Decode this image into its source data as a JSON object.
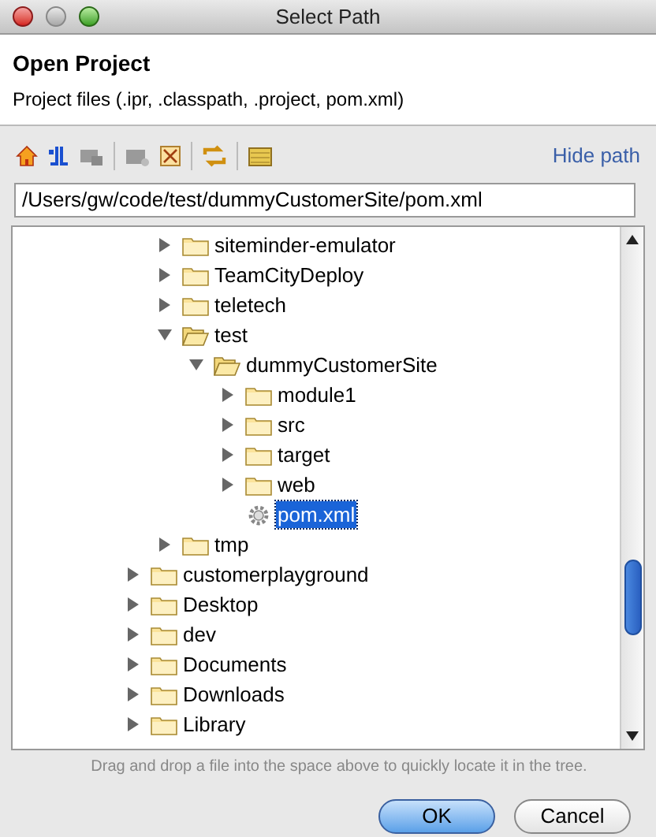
{
  "window": {
    "title": "Select Path"
  },
  "header": {
    "title": "Open Project",
    "subtitle": "Project files (.ipr, .classpath, .project, pom.xml)"
  },
  "toolbar": {
    "hide_path_link": "Hide path"
  },
  "path_field": {
    "value": "/Users/gw/code/test/dummyCustomerSite/pom.xml"
  },
  "tree": {
    "items": [
      {
        "children": [
          {
            "label": "siteminder-emulator",
            "kind": "folder",
            "expanded": false,
            "selected": false
          },
          {
            "label": "TeamCityDeploy",
            "kind": "folder",
            "expanded": false,
            "selected": false
          },
          {
            "label": "teletech",
            "kind": "folder",
            "expanded": false,
            "selected": false
          },
          {
            "label": "test",
            "kind": "folder",
            "expanded": true,
            "selected": false,
            "children": [
              {
                "label": "dummyCustomerSite",
                "kind": "folder",
                "expanded": true,
                "selected": false,
                "children": [
                  {
                    "label": "module1",
                    "kind": "folder",
                    "expanded": false,
                    "selected": false
                  },
                  {
                    "label": "src",
                    "kind": "folder",
                    "expanded": false,
                    "selected": false
                  },
                  {
                    "label": "target",
                    "kind": "folder",
                    "expanded": false,
                    "selected": false
                  },
                  {
                    "label": "web",
                    "kind": "folder",
                    "expanded": false,
                    "selected": false
                  },
                  {
                    "label": "pom.xml",
                    "kind": "file",
                    "selected": true
                  }
                ]
              }
            ]
          },
          {
            "label": "tmp",
            "kind": "folder",
            "expanded": false,
            "selected": false
          }
        ]
      },
      {
        "label": "customerplayground",
        "kind": "folder",
        "expanded": false,
        "selected": false
      },
      {
        "label": "Desktop",
        "kind": "folder",
        "expanded": false,
        "selected": false
      },
      {
        "label": "dev",
        "kind": "folder",
        "expanded": false,
        "selected": false
      },
      {
        "label": "Documents",
        "kind": "folder",
        "expanded": false,
        "selected": false
      },
      {
        "label": "Downloads",
        "kind": "folder",
        "expanded": false,
        "selected": false
      },
      {
        "label": "Library",
        "kind": "folder",
        "expanded": false,
        "selected": false
      }
    ]
  },
  "hint": "Drag and drop a file into the space above to quickly locate it in the tree.",
  "buttons": [
    {
      "label": "OK",
      "kind": "default"
    },
    {
      "label": "Cancel",
      "kind": "normal"
    }
  ]
}
